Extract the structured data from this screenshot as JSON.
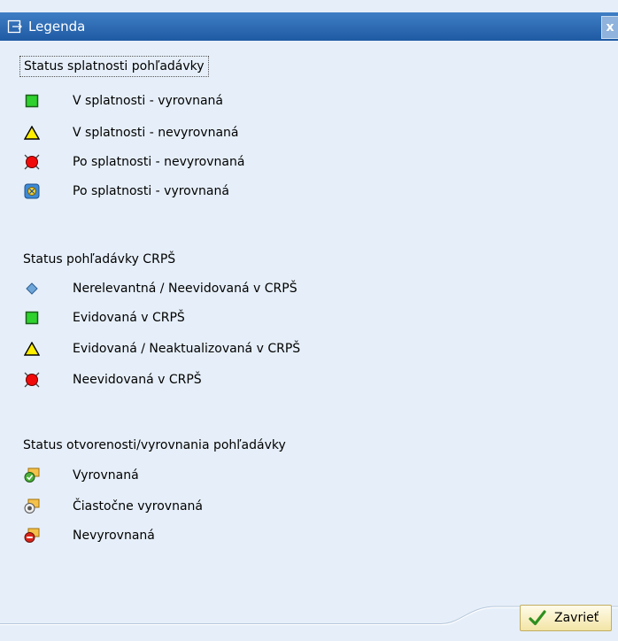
{
  "window": {
    "title": "Legenda",
    "close_glyph": "x"
  },
  "sections": [
    {
      "title": "Status splatnosti pohľadávky",
      "items": [
        {
          "icon": "green-square-icon",
          "label": "V splatnosti - vyrovnaná"
        },
        {
          "icon": "yellow-triangle-icon",
          "label": "V splatnosti - nevyrovnaná"
        },
        {
          "icon": "red-circle-icon",
          "label": "Po splatnosti - nevyrovnaná"
        },
        {
          "icon": "blue-yellow-square-icon",
          "label": "Po splatnosti - vyrovnaná"
        }
      ]
    },
    {
      "title": "Status pohľadávky CRPŠ",
      "items": [
        {
          "icon": "blue-diamond-icon",
          "label": "Nerelevantná / Neevidovaná v CRPŠ"
        },
        {
          "icon": "green-square-icon",
          "label": "Evidovaná v CRPŠ"
        },
        {
          "icon": "yellow-triangle-icon",
          "label": "Evidovaná / Neaktualizovaná v CRPŠ"
        },
        {
          "icon": "red-circle-icon",
          "label": "Neevidovaná v CRPŠ"
        }
      ]
    },
    {
      "title": "Status otvorenosti/vyrovnania pohľadávky",
      "items": [
        {
          "icon": "cleared-check-icon",
          "label": "Vyrovnaná"
        },
        {
          "icon": "partially-cleared-icon",
          "label": "Čiastočne vyrovnaná"
        },
        {
          "icon": "open-minus-icon",
          "label": "Nevyrovnaná"
        }
      ]
    }
  ],
  "footer": {
    "close_label": "Zavrieť"
  }
}
